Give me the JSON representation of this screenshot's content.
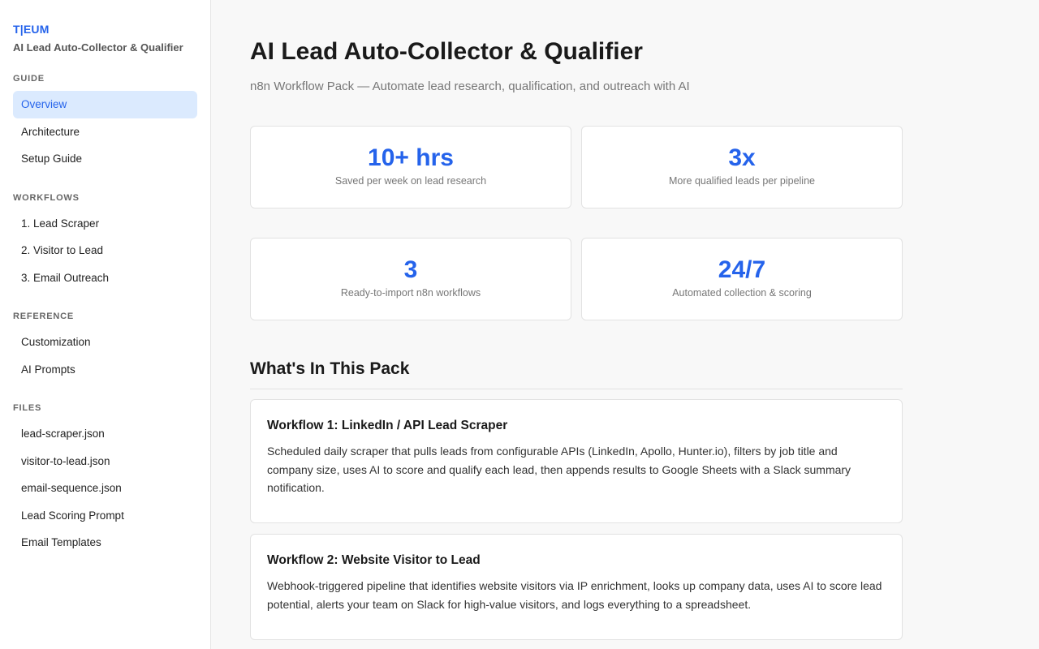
{
  "brand": {
    "logo": "T|EUM",
    "title": "AI Lead Auto-Collector & Qualifier"
  },
  "sidebar": {
    "sections": [
      {
        "heading": "GUIDE",
        "items": [
          "Overview",
          "Architecture",
          "Setup Guide"
        ]
      },
      {
        "heading": "WORKFLOWS",
        "items": [
          "1. Lead Scraper",
          "2. Visitor to Lead",
          "3. Email Outreach"
        ]
      },
      {
        "heading": "REFERENCE",
        "items": [
          "Customization",
          "AI Prompts"
        ]
      },
      {
        "heading": "FILES",
        "items": [
          "lead-scraper.json",
          "visitor-to-lead.json",
          "email-sequence.json",
          "Lead Scoring Prompt",
          "Email Templates"
        ]
      }
    ],
    "active_item": "Overview"
  },
  "main": {
    "title": "AI Lead Auto-Collector & Qualifier",
    "subtitle": "n8n Workflow Pack — Automate lead research, qualification, and outreach with AI",
    "stats": [
      {
        "value": "10+ hrs",
        "label": "Saved per week on lead research"
      },
      {
        "value": "3x",
        "label": "More qualified leads per pipeline"
      },
      {
        "value": "3",
        "label": "Ready-to-import n8n workflows"
      },
      {
        "value": "24/7",
        "label": "Automated collection & scoring"
      }
    ],
    "section_title": "What's In This Pack",
    "workflows": [
      {
        "title": "Workflow 1: LinkedIn / API Lead Scraper",
        "description": "Scheduled daily scraper that pulls leads from configurable APIs (LinkedIn, Apollo, Hunter.io), filters by job title and company size, uses AI to score and qualify each lead, then appends results to Google Sheets with a Slack summary notification."
      },
      {
        "title": "Workflow 2: Website Visitor to Lead",
        "description": "Webhook-triggered pipeline that identifies website visitors via IP enrichment, looks up company data, uses AI to score lead potential, alerts your team on Slack for high-value visitors, and logs everything to a spreadsheet."
      }
    ]
  },
  "colors": {
    "accent": "#2563eb",
    "active_bg": "#dbeafe"
  }
}
